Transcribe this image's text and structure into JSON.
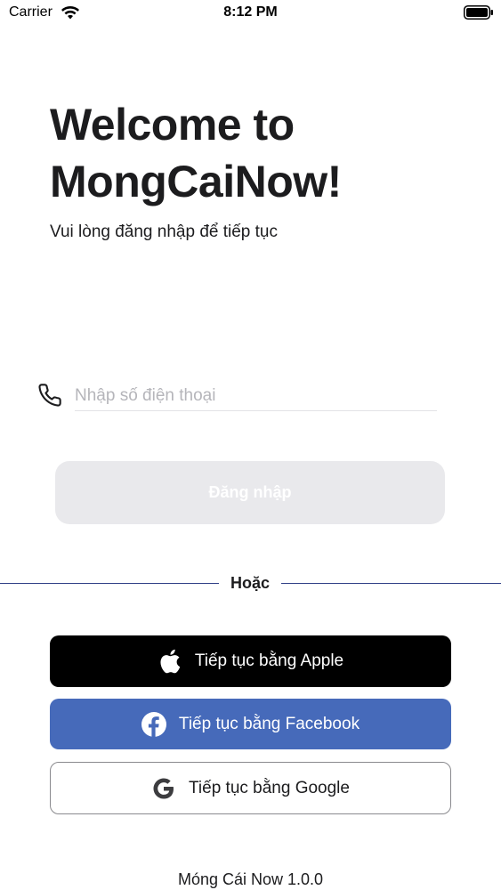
{
  "status_bar": {
    "carrier": "Carrier",
    "time": "8:12 PM"
  },
  "welcome": {
    "title": "Welcome to MongCaiNow!",
    "subtitle": "Vui lòng đăng nhập để tiếp tục"
  },
  "phone": {
    "placeholder": "Nhập số điện thoại",
    "value": ""
  },
  "login_button": {
    "label": "Đăng nhập"
  },
  "divider": {
    "label": "Hoặc"
  },
  "social": {
    "apple_label": "Tiếp tục bằng Apple",
    "facebook_label": "Tiếp tục bằng Facebook",
    "google_label": "Tiếp tục bằng Google"
  },
  "footer": {
    "version": "Móng Cái Now 1.0.0"
  },
  "colors": {
    "facebook": "#466aba",
    "apple": "#000000",
    "divider": "#2f3f86",
    "login_disabled": "#e9e9ec"
  },
  "icons": [
    "wifi-icon",
    "battery-icon",
    "phone-icon",
    "apple-icon",
    "facebook-icon",
    "google-icon"
  ]
}
